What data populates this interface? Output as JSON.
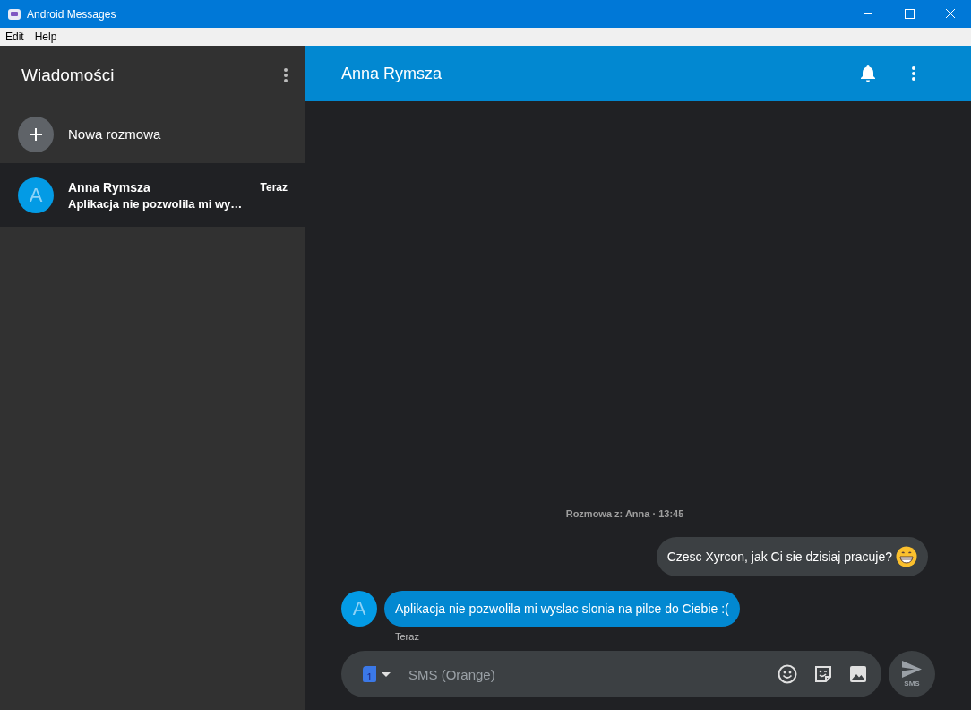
{
  "window": {
    "title": "Android Messages"
  },
  "menu_bar": [
    "Edit",
    "Help"
  ],
  "sidebar": {
    "title": "Wiadomości",
    "new_conversation": "Nowa rozmowa",
    "conversations": [
      {
        "avatar": "A",
        "name": "Anna Rymsza",
        "time": "Teraz",
        "preview": "Aplikacja nie pozwolila mi wy…",
        "selected": true
      }
    ]
  },
  "chat": {
    "title": "Anna Rymsza",
    "info": "Rozmowa z: Anna · 13:45",
    "messages": [
      {
        "kind": "outgoing",
        "text": "Czesc Xyrcon, jak Ci sie dzisiaj pracuje?",
        "emoji": true
      },
      {
        "kind": "incoming",
        "avatar": "A",
        "text": "Aplikacja nie pozwolila mi wyslac slonia na pilce do Ciebie :(",
        "time": "Teraz"
      }
    ],
    "composer": {
      "sim": "1",
      "placeholder": "SMS (Orange)",
      "send_label": "SMS"
    }
  }
}
